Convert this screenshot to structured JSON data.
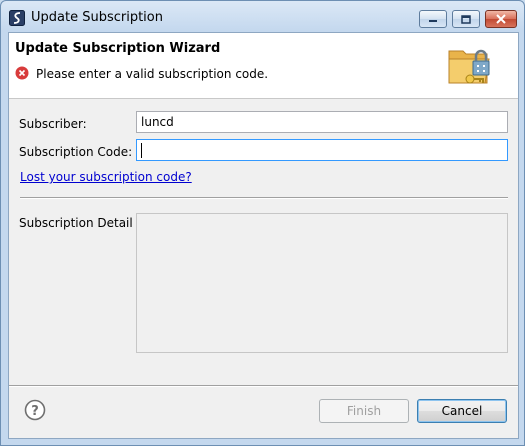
{
  "window": {
    "title": "Update Subscription"
  },
  "header": {
    "title": "Update Subscription Wizard",
    "message": "Please enter a valid subscription code."
  },
  "form": {
    "subscriber_label": "Subscriber:",
    "subscriber_value": "luncd",
    "code_label": "Subscription Code:",
    "code_value": "",
    "lost_link": "Lost your subscription code?",
    "detail_label": "Subscription Detail"
  },
  "buttons": {
    "finish": "Finish",
    "cancel": "Cancel"
  },
  "icons": {
    "app": "app-logo-icon",
    "error": "error-icon",
    "banner": "folder-lock-key-icon",
    "help": "help-icon"
  },
  "colors": {
    "link": "#0000d0",
    "error": "#d83b3b",
    "focus_border": "#3399ff"
  }
}
